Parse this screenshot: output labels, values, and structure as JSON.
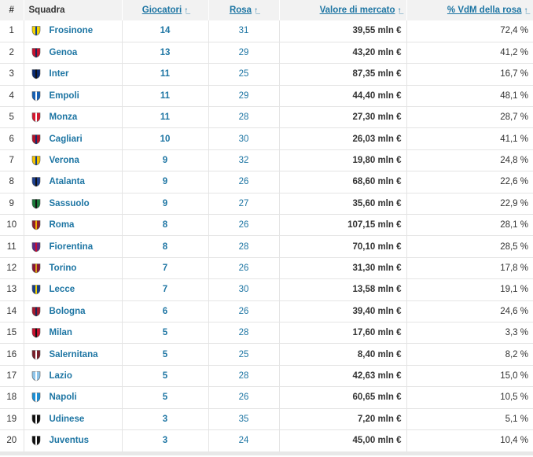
{
  "header": {
    "rank": "#",
    "club": "Squadra",
    "players": "Giocatori",
    "squad": "Rosa",
    "value": "Valore di mercato",
    "pct": "% VdM della rosa",
    "sort_icon": "sort-arrow-icon"
  },
  "rows": [
    {
      "rank": "1",
      "club": "Frosinone",
      "players": "14",
      "squad": "31",
      "value": "39,55 mln €",
      "pct": "72,4 %",
      "crest": "frosinone-crest-icon",
      "c1": "#f3d400",
      "c2": "#0d3c8c"
    },
    {
      "rank": "2",
      "club": "Genoa",
      "players": "13",
      "squad": "29",
      "value": "43,20 mln €",
      "pct": "41,2 %",
      "crest": "genoa-crest-icon",
      "c1": "#c8102e",
      "c2": "#1a2a56"
    },
    {
      "rank": "3",
      "club": "Inter",
      "players": "11",
      "squad": "25",
      "value": "87,35 mln €",
      "pct": "16,7 %",
      "crest": "inter-crest-icon",
      "c1": "#0a2a72",
      "c2": "#111111"
    },
    {
      "rank": "4",
      "club": "Empoli",
      "players": "11",
      "squad": "29",
      "value": "44,40 mln €",
      "pct": "48,1 %",
      "crest": "empoli-crest-icon",
      "c1": "#1660b5",
      "c2": "#ffffff"
    },
    {
      "rank": "5",
      "club": "Monza",
      "players": "11",
      "squad": "28",
      "value": "27,30 mln €",
      "pct": "28,7 %",
      "crest": "monza-crest-icon",
      "c1": "#d6162e",
      "c2": "#ffffff"
    },
    {
      "rank": "6",
      "club": "Cagliari",
      "players": "10",
      "squad": "30",
      "value": "26,03 mln €",
      "pct": "41,1 %",
      "crest": "cagliari-crest-icon",
      "c1": "#b5122a",
      "c2": "#0f2d6b"
    },
    {
      "rank": "7",
      "club": "Verona",
      "players": "9",
      "squad": "32",
      "value": "19,80 mln €",
      "pct": "24,8 %",
      "crest": "verona-crest-icon",
      "c1": "#f2c200",
      "c2": "#0f3c8a"
    },
    {
      "rank": "8",
      "club": "Atalanta",
      "players": "9",
      "squad": "26",
      "value": "68,60 mln €",
      "pct": "22,6 %",
      "crest": "atalanta-crest-icon",
      "c1": "#1d3f8f",
      "c2": "#111111"
    },
    {
      "rank": "9",
      "club": "Sassuolo",
      "players": "9",
      "squad": "27",
      "value": "35,60 mln €",
      "pct": "22,9 %",
      "crest": "sassuolo-crest-icon",
      "c1": "#1a7a3a",
      "c2": "#111111"
    },
    {
      "rank": "10",
      "club": "Roma",
      "players": "8",
      "squad": "26",
      "value": "107,15 mln €",
      "pct": "28,1 %",
      "crest": "roma-crest-icon",
      "c1": "#8e1f2f",
      "c2": "#f0b400"
    },
    {
      "rank": "11",
      "club": "Fiorentina",
      "players": "8",
      "squad": "28",
      "value": "70,10 mln €",
      "pct": "28,5 %",
      "crest": "fiorentina-crest-icon",
      "c1": "#5b2a86",
      "c2": "#c8102e"
    },
    {
      "rank": "12",
      "club": "Torino",
      "players": "7",
      "squad": "26",
      "value": "31,30 mln €",
      "pct": "17,8 %",
      "crest": "torino-crest-icon",
      "c1": "#8a1538",
      "c2": "#d4a017"
    },
    {
      "rank": "13",
      "club": "Lecce",
      "players": "7",
      "squad": "30",
      "value": "13,58 mln €",
      "pct": "19,1 %",
      "crest": "lecce-crest-icon",
      "c1": "#1a3f8a",
      "c2": "#f3d400"
    },
    {
      "rank": "14",
      "club": "Bologna",
      "players": "6",
      "squad": "26",
      "value": "39,40 mln €",
      "pct": "24,6 %",
      "crest": "bologna-crest-icon",
      "c1": "#a6192e",
      "c2": "#1a2a56"
    },
    {
      "rank": "15",
      "club": "Milan",
      "players": "5",
      "squad": "28",
      "value": "17,60 mln €",
      "pct": "3,3 %",
      "crest": "milan-crest-icon",
      "c1": "#c8102e",
      "c2": "#111111"
    },
    {
      "rank": "16",
      "club": "Salernitana",
      "players": "5",
      "squad": "25",
      "value": "8,40 mln €",
      "pct": "8,2 %",
      "crest": "salernitana-crest-icon",
      "c1": "#7a1f2b",
      "c2": "#ffffff"
    },
    {
      "rank": "17",
      "club": "Lazio",
      "players": "5",
      "squad": "28",
      "value": "42,63 mln €",
      "pct": "15,0 %",
      "crest": "lazio-crest-icon",
      "c1": "#8ec5ea",
      "c2": "#ffffff"
    },
    {
      "rank": "18",
      "club": "Napoli",
      "players": "5",
      "squad": "26",
      "value": "60,65 mln €",
      "pct": "10,5 %",
      "crest": "napoli-crest-icon",
      "c1": "#1b8fd6",
      "c2": "#ffffff"
    },
    {
      "rank": "19",
      "club": "Udinese",
      "players": "3",
      "squad": "35",
      "value": "7,20 mln €",
      "pct": "5,1 %",
      "crest": "udinese-crest-icon",
      "c1": "#111111",
      "c2": "#ffffff"
    },
    {
      "rank": "20",
      "club": "Juventus",
      "players": "3",
      "squad": "24",
      "value": "45,00 mln €",
      "pct": "10,4 %",
      "crest": "juventus-crest-icon",
      "c1": "#111111",
      "c2": "#ffffff"
    }
  ],
  "colors": {
    "link": "#1d75a3",
    "header_bg": "#f2f2f2",
    "row_border": "#e4e4e4"
  }
}
